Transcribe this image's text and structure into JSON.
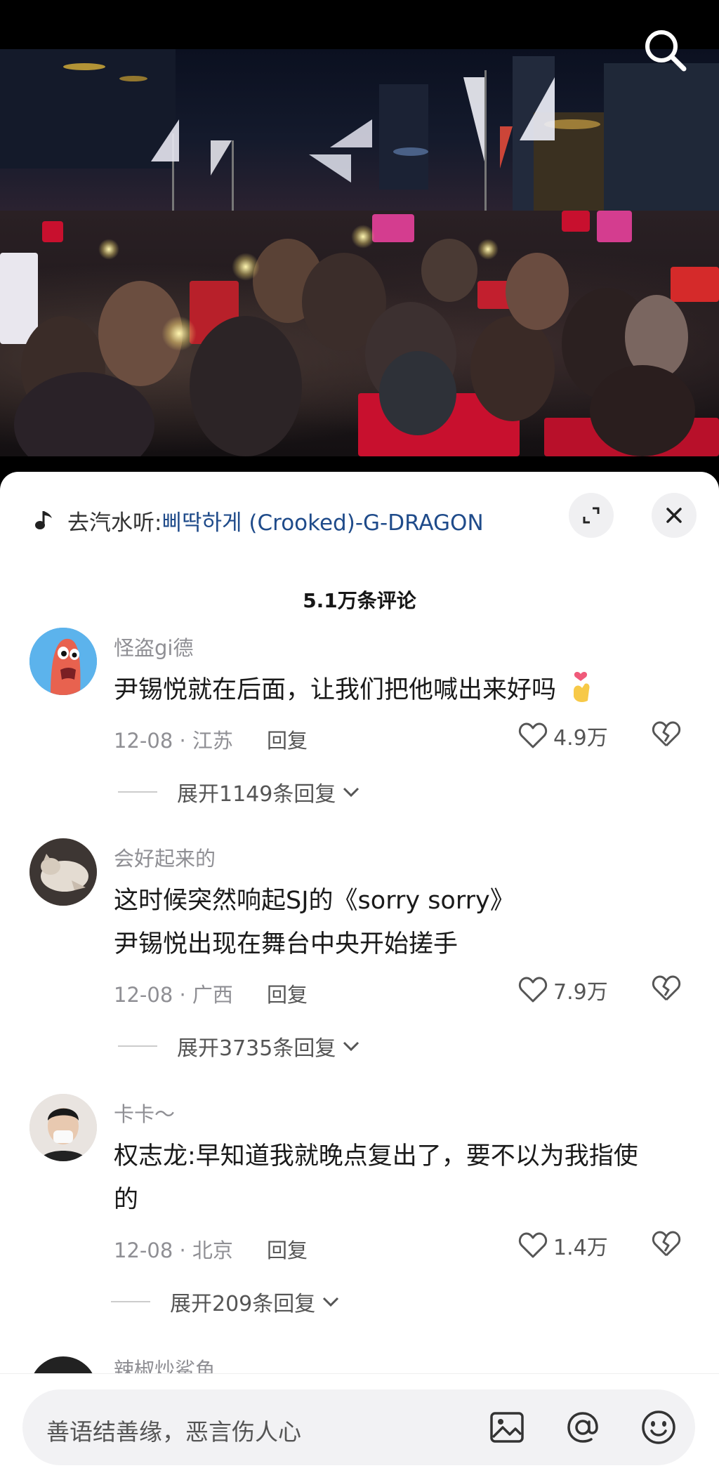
{
  "music": {
    "prefix": "去汽水听: ",
    "song": "삐딱하게 (Crooked)-G-DRAGON"
  },
  "comments_header": "5.1万条评论",
  "comments": [
    {
      "username": "怪盗gi德",
      "lines": [
        "尹锡悦就在后面，让我们把他喊出来好吗"
      ],
      "meta": "12-08 · 江苏",
      "reply": "回复",
      "likes": "4.9万",
      "expand": "展开1149条回复"
    },
    {
      "username": "会好起来的",
      "lines": [
        "这时候突然响起SJ的《sorry sorry》",
        "尹锡悦出现在舞台中央开始搓手"
      ],
      "meta": "12-08 · 广西",
      "reply": "回复",
      "likes": "7.9万",
      "expand": "展开3735条回复"
    },
    {
      "username": "卡卡～",
      "lines": [
        "权志龙:早知道我就晚点复出了，要不以为我指使",
        "的"
      ],
      "meta": "12-08 · 北京",
      "reply": "回复",
      "likes": "1.4万",
      "expand": "展开209条回复"
    },
    {
      "username": "辣椒炒鲨鱼"
    }
  ],
  "input": {
    "placeholder": "善语结善缘，恶言伤人心"
  },
  "colors": {
    "song_link": "#1f4b8a",
    "muted_text": "#8f8f94"
  }
}
